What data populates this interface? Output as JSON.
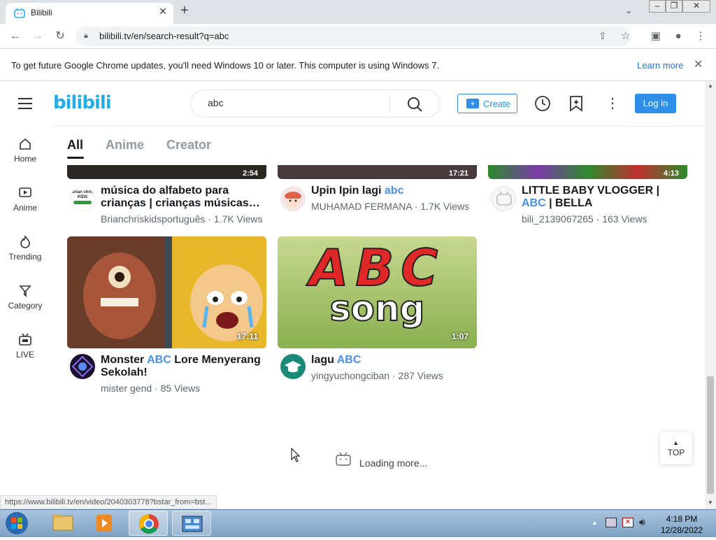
{
  "browser": {
    "tab_title": "Bilibili",
    "url": "bilibili.tv/en/search-result?q=abc",
    "infobar_message": "To get future Google Chrome updates, you'll need Windows 10 or later. This computer is using Windows 7.",
    "infobar_link": "Learn more",
    "status_url": "https://www.bilibili.tv/en/video/2040303778?bstar_from=bst..."
  },
  "header": {
    "logo": "bilibili",
    "search_value": "abc",
    "create_label": "Create",
    "login_label": "Log in"
  },
  "sidebar": {
    "items": [
      {
        "label": "Home"
      },
      {
        "label": "Anime"
      },
      {
        "label": "Trending"
      },
      {
        "label": "Category"
      },
      {
        "label": "LIVE"
      }
    ]
  },
  "tabs": [
    "All",
    "Anime",
    "Creator"
  ],
  "top_row": [
    {
      "duration": "2:54",
      "title_line1": "música do alfabeto para",
      "title_line2": "crianças | crianças músicas…",
      "channel": "Brianchriskidsportuguês",
      "views": "1.7K Views"
    },
    {
      "duration": "17:21",
      "title_pre": "Upin Ipin lagi ",
      "title_hl": "abc",
      "channel": "MUHAMAD FERMANA",
      "views": "1.7K Views"
    },
    {
      "duration": "4:13",
      "title_line1": "LITTLE BABY VLOGGER |",
      "title_hl": "ABC",
      "title_post": " | BELLA",
      "channel": "bili_2139067265",
      "views": "163 Views"
    }
  ],
  "bottom_row": [
    {
      "duration": "17:11",
      "title_pre": "Monster ",
      "title_hl": "ABC",
      "title_post": " Lore Menyerang",
      "title_line2": "Sekolah!",
      "channel": "mister gend",
      "views": "85 Views"
    },
    {
      "duration": "1:07",
      "title_pre": "lagu ",
      "title_hl": "ABC",
      "channel": "yingyuchongciban",
      "views": "287 Views",
      "thumb_text_1": "ABC",
      "thumb_text_2": "song"
    }
  ],
  "avatar_badge": "Brian chris KIDS",
  "loading_text": "Loading more...",
  "top_button": "TOP",
  "sep": " · ",
  "taskbar": {
    "time": "4:18 PM",
    "date": "12/28/2022"
  },
  "colors": {
    "brand": "#23ade5",
    "accent": "#2f8fe8",
    "highlight": "#4a90e2"
  }
}
